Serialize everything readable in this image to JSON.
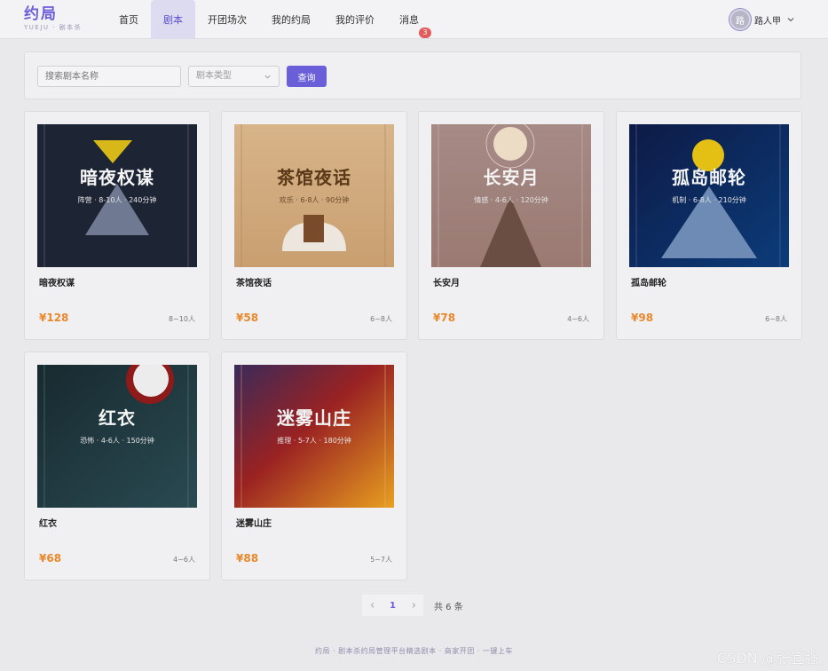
{
  "header": {
    "logo": "约局",
    "logo_sub": "YUEJU · 剧本杀",
    "nav": [
      {
        "label": "首页"
      },
      {
        "label": "剧本"
      },
      {
        "label": "开团场次"
      },
      {
        "label": "我的约局"
      },
      {
        "label": "我的评价"
      },
      {
        "label": "消息",
        "badge": "3"
      }
    ],
    "active_nav": "剧本",
    "user": {
      "avatar_char": "路",
      "name": "路人甲"
    }
  },
  "search": {
    "name_placeholder": "搜索剧本名称",
    "type_placeholder": "剧本类型",
    "query_label": "查询"
  },
  "scripts": [
    {
      "title": "暗夜权谋",
      "meta": "阵营 · 8-10人 · 240分钟",
      "name": "暗夜权谋",
      "price": "¥128",
      "players": "8~10人"
    },
    {
      "title": "茶馆夜话",
      "meta": "欢乐 · 6-8人 · 90分钟",
      "name": "茶馆夜话",
      "price": "¥58",
      "players": "6~8人"
    },
    {
      "title": "长安月",
      "meta": "情感 · 4-6人 · 120分钟",
      "name": "长安月",
      "price": "¥78",
      "players": "4~6人"
    },
    {
      "title": "孤岛邮轮",
      "meta": "机制 · 6-8人 · 210分钟",
      "name": "孤岛邮轮",
      "price": "¥98",
      "players": "6~8人"
    },
    {
      "title": "红衣",
      "meta": "恐怖 · 4-6人 · 150分钟",
      "name": "红衣",
      "price": "¥68",
      "players": "4~6人"
    },
    {
      "title": "迷雾山庄",
      "meta": "推理 · 5-7人 · 180分钟",
      "name": "迷雾山庄",
      "price": "¥88",
      "players": "5~7人"
    }
  ],
  "pagination": {
    "current": "1",
    "total": "共 6 条"
  },
  "footer": "约局 · 剧本杀约局管理平台精选剧本 · 商家开团 · 一键上车",
  "watermark": "CSDN @张宜强",
  "colors": {
    "accent": "#6b5fd9",
    "price": "#e8882a",
    "badge": "#e25c5c"
  }
}
